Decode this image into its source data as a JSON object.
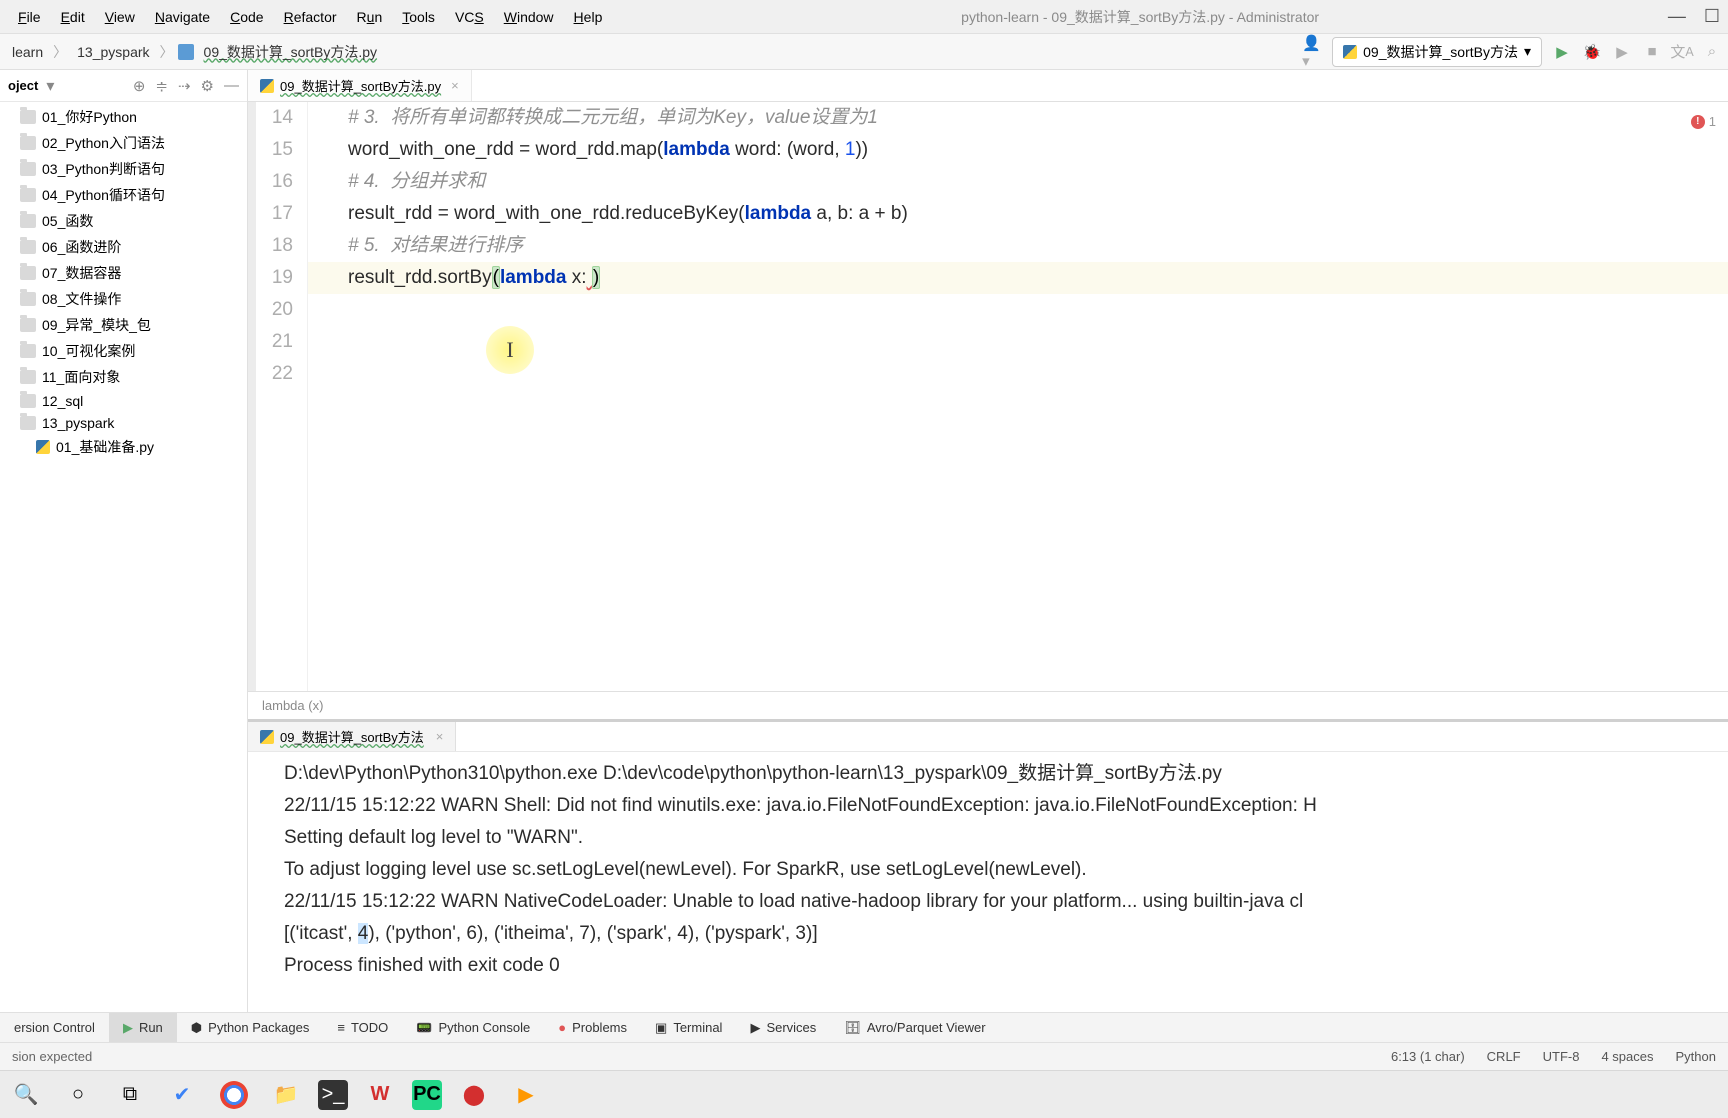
{
  "menu": {
    "items": [
      "File",
      "Edit",
      "View",
      "Navigate",
      "Code",
      "Refactor",
      "Run",
      "Tools",
      "VCS",
      "Window",
      "Help"
    ]
  },
  "window_title": "python-learn - 09_数据计算_sortBy方法.py - Administrator",
  "breadcrumbs": {
    "c0": "learn",
    "c1": "13_pyspark",
    "c2": "09_数据计算_sortBy方法.py"
  },
  "run_config_name": "09_数据计算_sortBy方法",
  "project_panel_label": "oject",
  "tree": {
    "i0": "01_你好Python",
    "i1": "02_Python入门语法",
    "i2": "03_Python判断语句",
    "i3": "04_Python循环语句",
    "i4": "05_函数",
    "i5": "06_函数进阶",
    "i6": "07_数据容器",
    "i7": "08_文件操作",
    "i8": "09_异常_模块_包",
    "i9": "10_可视化案例",
    "i10": "11_面向对象",
    "i11": "12_sql",
    "i12": "13_pyspark",
    "i13": "01_基础准备.py"
  },
  "editor_tab": "09_数据计算_sortBy方法.py",
  "error_count": "1",
  "gutter": {
    "l14": "14",
    "l15": "15",
    "l16": "16",
    "l17": "17",
    "l18": "18",
    "l19": "19",
    "l20": "20",
    "l21": "21",
    "l22": "22"
  },
  "code": {
    "l14": "# 3.  将所有单词都转换成二元元组，单词为Key，value设置为1",
    "l15a": "word_with_one_rdd = word_rdd.map(",
    "l15b": "lambda",
    "l15c": " word: (word, ",
    "l15d": "1",
    "l15e": "))",
    "l16": "# 4.  分组并求和",
    "l17a": "result_rdd = word_with_one_rdd.reduceByKey(",
    "l17b": "lambda",
    "l17c": " a, b: a + b)",
    "l18": "# 5.  对结果进行排序",
    "l19a": "result_rdd.sortBy",
    "l19b": "(",
    "l19c": "lambda",
    "l19d": " x:",
    "l19e": " ",
    "l19f": ")"
  },
  "editor_breadcrumb": "lambda (x)",
  "run_tab_name": "09_数据计算_sortBy方法",
  "console": {
    "l0": "D:\\dev\\Python\\Python310\\python.exe D:\\dev\\code\\python\\python-learn\\13_pyspark\\09_数据计算_sortBy方法.py",
    "l1": "22/11/15 15:12:22 WARN Shell: Did not find winutils.exe: java.io.FileNotFoundException: java.io.FileNotFoundException: H",
    "l2": "Setting default log level to \"WARN\".",
    "l3": "To adjust logging level use sc.setLogLevel(newLevel). For SparkR, use setLogLevel(newLevel).",
    "l4": "22/11/15 15:12:22 WARN NativeCodeLoader: Unable to load native-hadoop library for your platform... using builtin-java cl",
    "l5a": "[('itcast', ",
    "l5b": "4",
    "l5c": "), ('python', 6), ('itheima', 7), ('spark', 4), ('pyspark', 3)]",
    "l6": "",
    "l7": "Process finished with exit code 0"
  },
  "bottom_tabs": {
    "t0": "ersion Control",
    "t1": "Run",
    "t2": "Python Packages",
    "t3": "TODO",
    "t4": "Python Console",
    "t5": "Problems",
    "t6": "Terminal",
    "t7": "Services",
    "t8": "Avro/Parquet Viewer"
  },
  "status": {
    "left": "sion expected",
    "pos": "6:13 (1 char)",
    "sep": "CRLF",
    "enc": "UTF-8",
    "indent": "4 spaces",
    "lang": "Python"
  }
}
